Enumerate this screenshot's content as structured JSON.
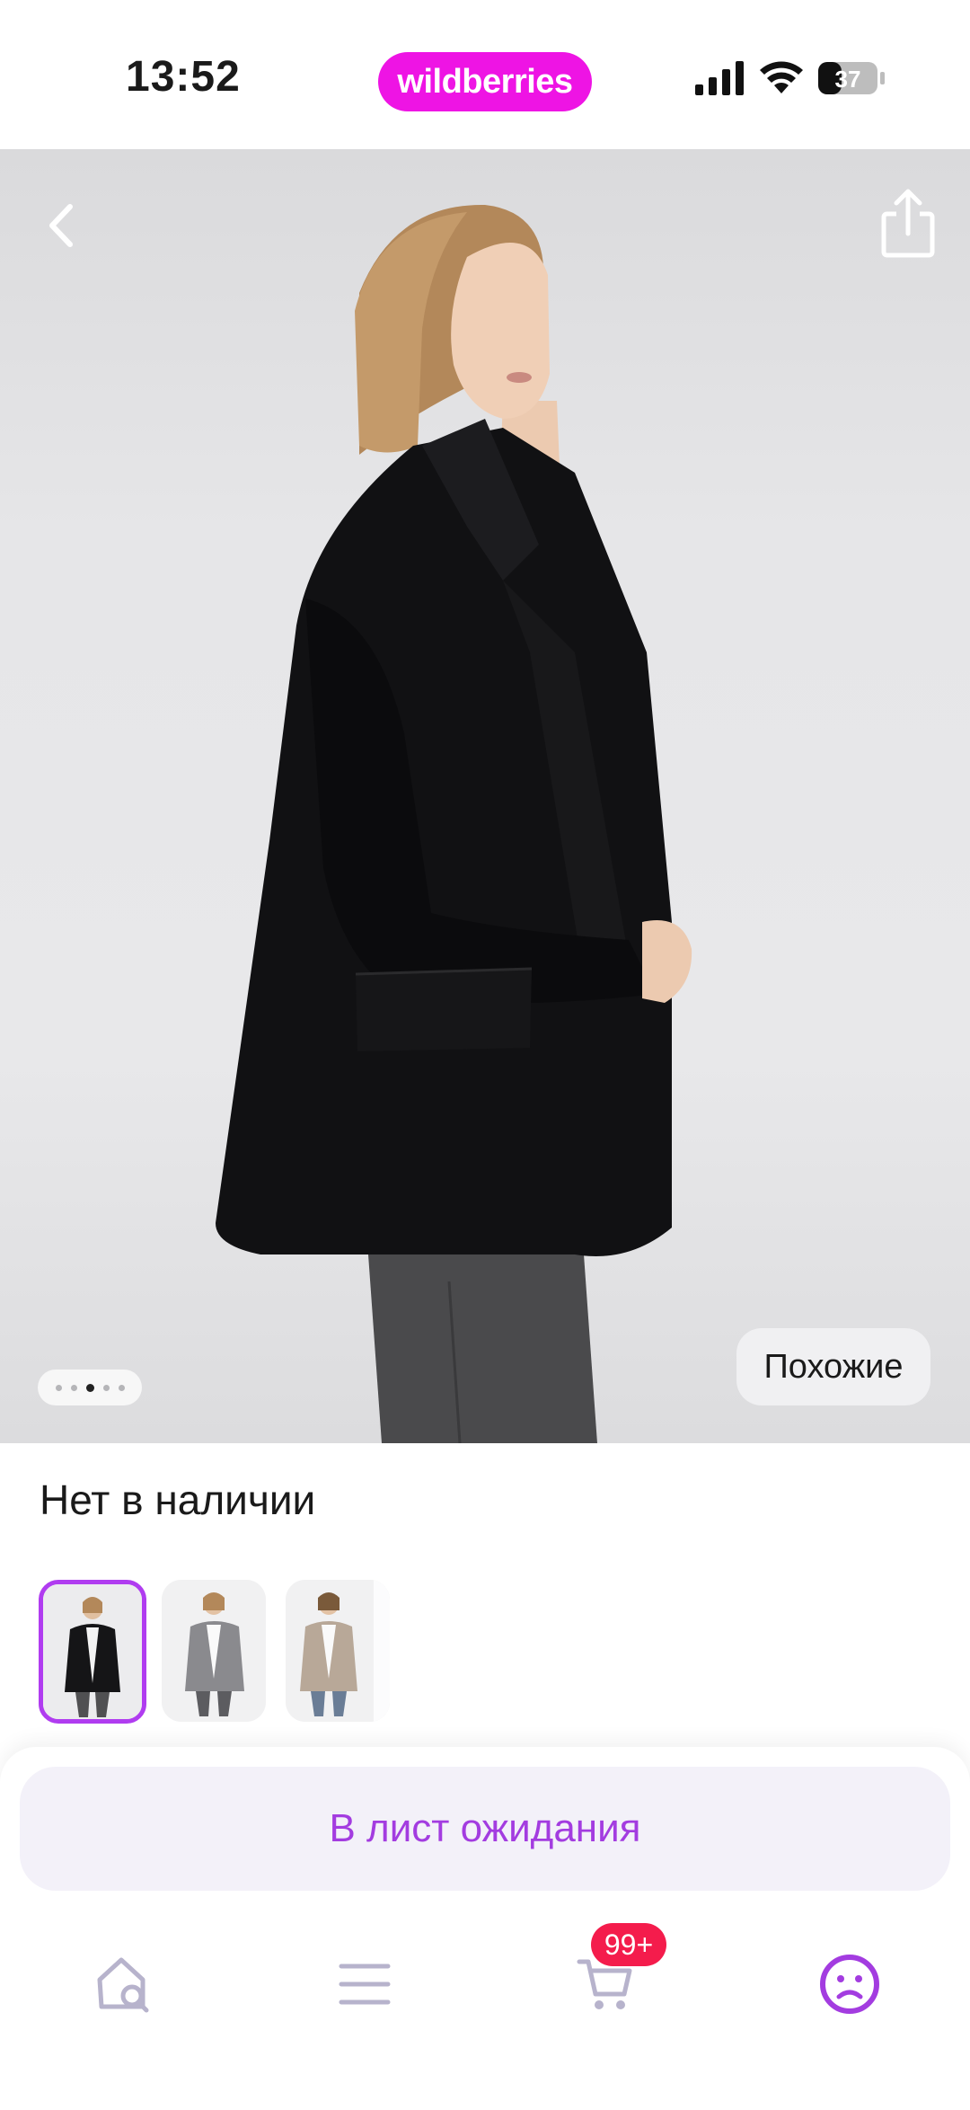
{
  "status_bar": {
    "time": "13:52",
    "brand": "wildberries",
    "battery": "37"
  },
  "hero": {
    "back_icon": "chevron-left-icon",
    "share_icon": "share-icon",
    "similar_label": "Похожие",
    "gallery_pages": 5,
    "gallery_active": 3
  },
  "product": {
    "availability": "Нет в наличии"
  },
  "thumbnails": [
    {
      "name": "thumb-black-blazer",
      "selected": true
    },
    {
      "name": "thumb-grey-blazer",
      "selected": false
    },
    {
      "name": "thumb-beige-blazer",
      "selected": false
    }
  ],
  "actions": {
    "waitlist_label": "В лист ожидания"
  },
  "nav": {
    "items": [
      "home-search-icon",
      "catalog-menu-icon",
      "cart-icon",
      "profile-icon"
    ],
    "cart_badge": "99+",
    "active": "profile-icon"
  },
  "colors": {
    "brand": "#ee14e4",
    "accent": "#a33ce0",
    "badge": "#f41c4c"
  }
}
